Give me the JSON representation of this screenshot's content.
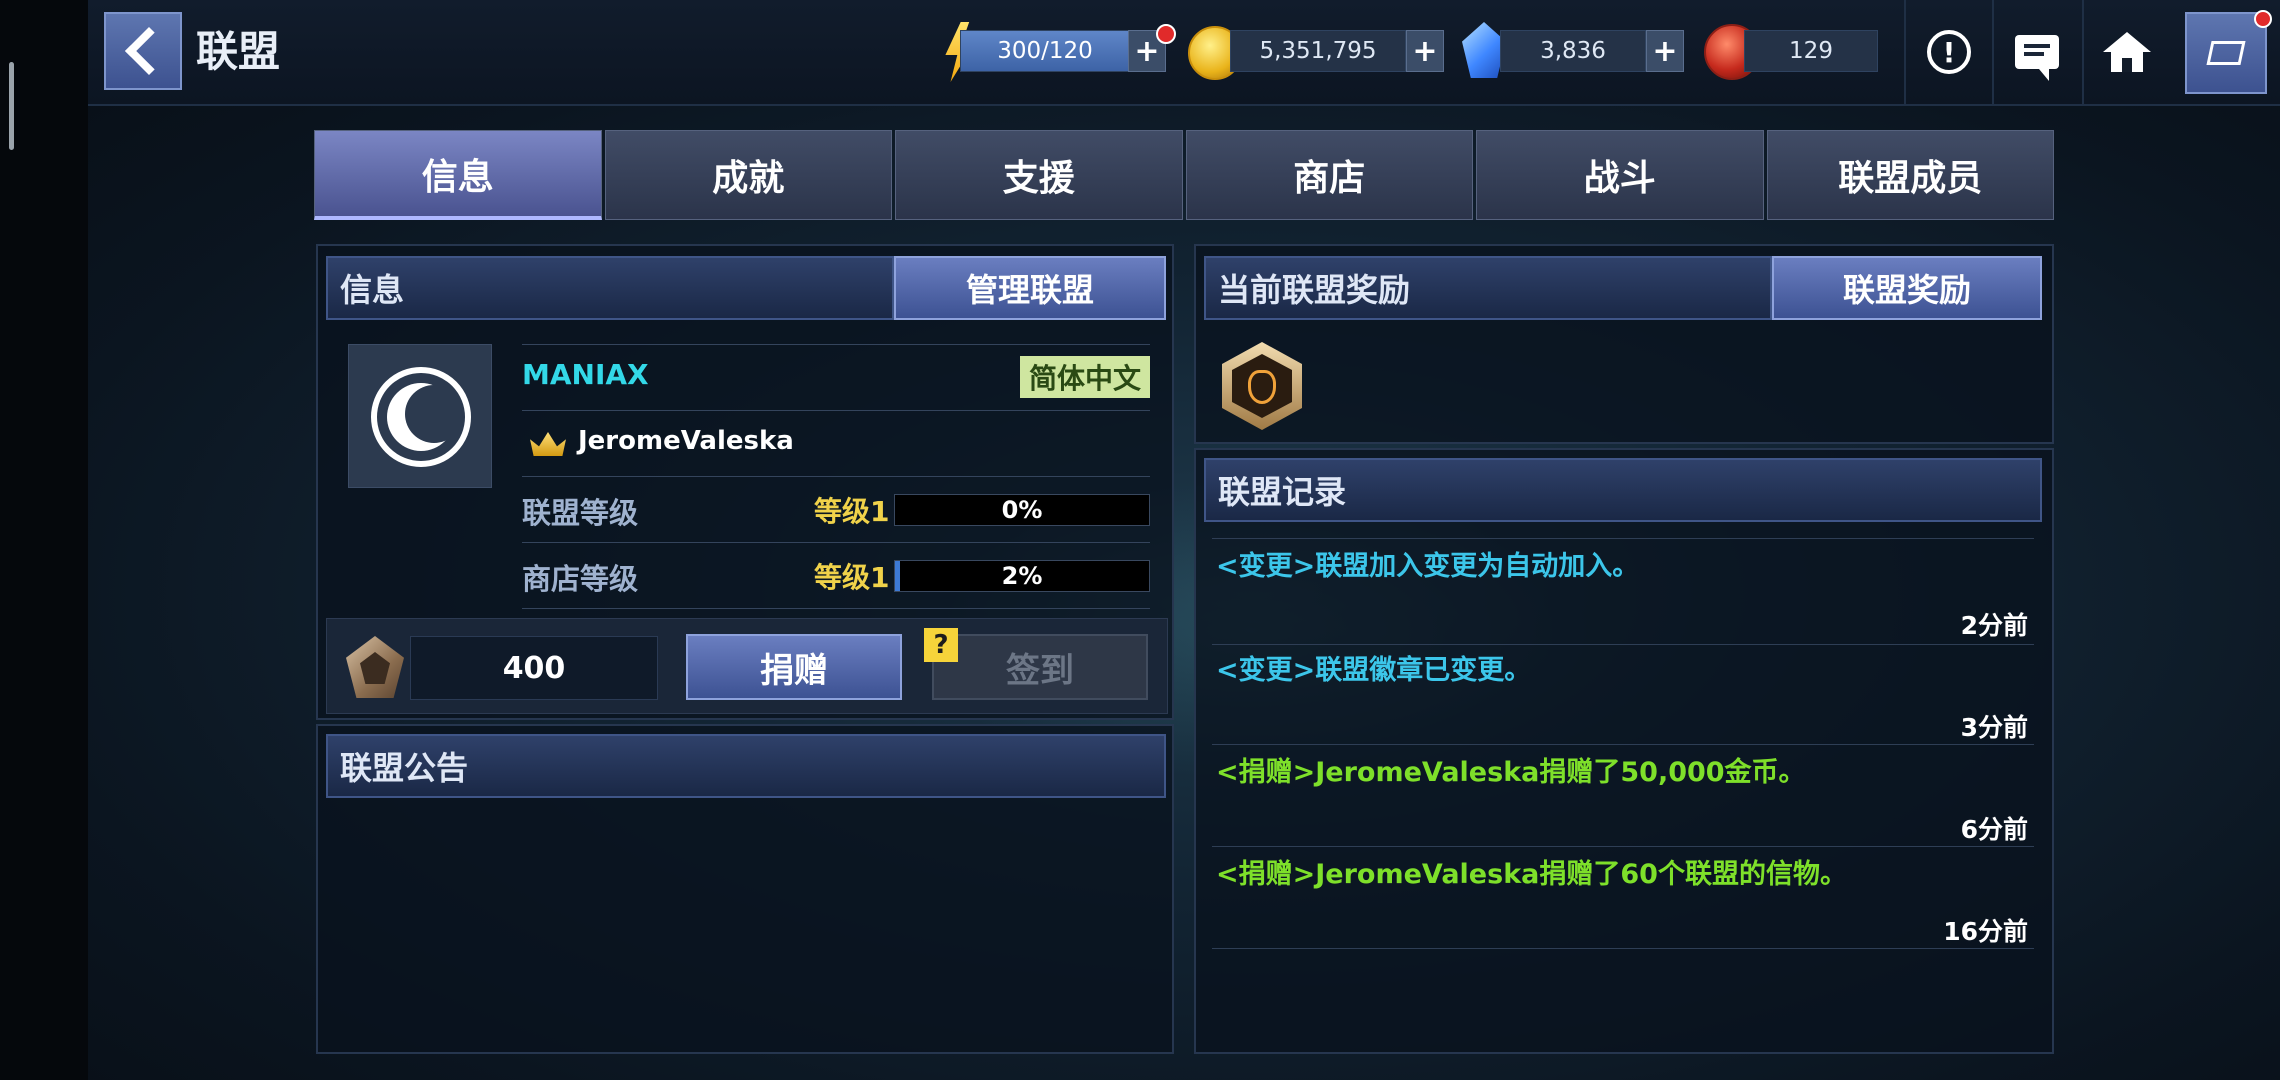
{
  "header": {
    "title": "联盟",
    "energy": "300/120",
    "gold": "5,351,795",
    "crystals": "3,836",
    "gems": "129"
  },
  "tabs": [
    "信息",
    "成就",
    "支援",
    "商店",
    "战斗",
    "联盟成员"
  ],
  "info": {
    "header": "信息",
    "manage_label": "管理联盟",
    "guild_name": "MANIAX",
    "language": "简体中文",
    "leader": "JeromeValeska",
    "stats": [
      {
        "label": "联盟等级",
        "level": "等级1",
        "progress_text": "0%",
        "progress": 0
      },
      {
        "label": "商店等级",
        "level": "等级1",
        "progress_text": "2%",
        "progress": 0.02
      }
    ],
    "donation_count": "400",
    "donate_label": "捐赠",
    "checkin_label": "签到",
    "help_label": "?"
  },
  "announcement": {
    "header": "联盟公告"
  },
  "rewards": {
    "header": "当前联盟奖励",
    "button_label": "联盟奖励"
  },
  "log": {
    "header": "联盟记录",
    "entries": [
      {
        "text": "<变更>联盟加入变更为自动加入。",
        "time": "2分前",
        "kind": "change"
      },
      {
        "text": "<变更>联盟徽章已变更。",
        "time": "3分前",
        "kind": "change"
      },
      {
        "text": "<捐赠>JeromeValeska捐赠了50,000金币。",
        "time": "6分前",
        "kind": "donate"
      },
      {
        "text": "<捐赠>JeromeValeska捐赠了60个联盟的信物。",
        "time": "16分前",
        "kind": "donate"
      }
    ]
  },
  "colors": {
    "change_text": "#3cc6ea",
    "donate_text": "#7ee02a",
    "guild_name": "#33d8e8",
    "level_text": "#f0d24a",
    "progress_fill": "#3d7ad6"
  }
}
